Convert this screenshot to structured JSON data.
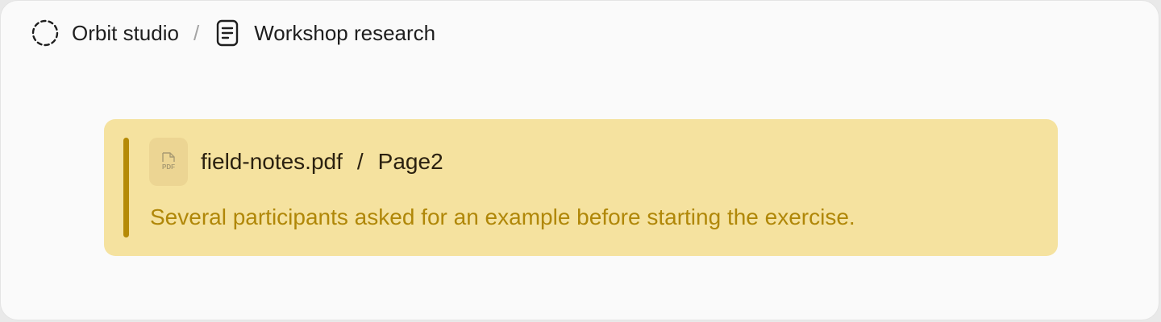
{
  "breadcrumb": {
    "workspace": {
      "label": "Orbit studio",
      "icon": "dashed-circle-icon"
    },
    "separator": "/",
    "document": {
      "label": "Workshop research",
      "icon": "document-icon"
    }
  },
  "citation": {
    "file_name": "field-notes.pdf",
    "file_icon": "pdf-file-icon",
    "file_icon_text": "PDF",
    "separator": "/",
    "page_label": "Page2",
    "quote": "Several participants asked for an example before starting the exercise.",
    "colors": {
      "background": "#f5e29f",
      "accent_bar": "#b58a06",
      "quote_text": "#b08708"
    }
  }
}
